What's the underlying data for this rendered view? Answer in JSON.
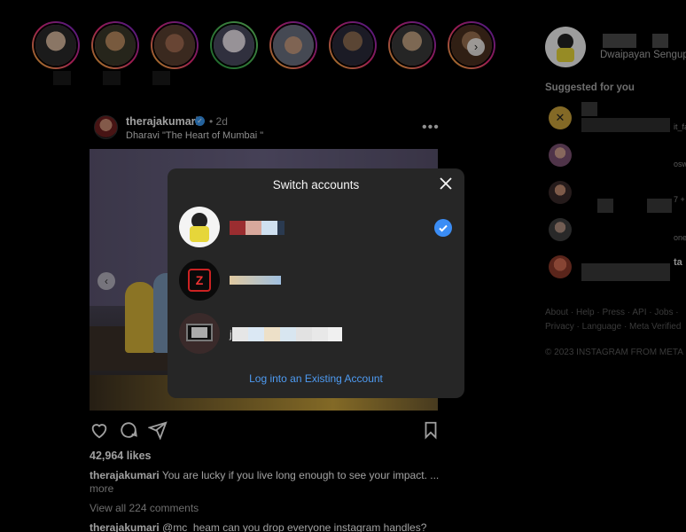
{
  "post": {
    "username": "therajakumari",
    "time": "2d",
    "location": "Dharavi \"The Heart of Mumbai \"",
    "likes": "42,964 likes",
    "caption_user": "therajakumari",
    "caption_text": "You are lucky if you live long enough to see your impact. ...",
    "caption_more": "more",
    "view_comments": "View all 224 comments",
    "comment_user": "therajakumari",
    "comment_text": "@mc_heam can you drop everyone instagram handles?"
  },
  "sidebar": {
    "full_name": "Dwaipayan Sengupta",
    "suggested_title": "Suggested for you",
    "suggestion_fragments": [
      "it_fa",
      "osw",
      "7 +",
      "one",
      "ta"
    ],
    "footer_links": "About · Help · Press · API · Jobs · Privacy · Language · Meta Verified",
    "copyright": "© 2023 INSTAGRAM FROM META"
  },
  "modal": {
    "title": "Switch accounts",
    "account_3_initial": "j",
    "login_link": "Log into an Existing Account"
  },
  "colors": {
    "accent_blue": "#3b8df5",
    "link_blue": "#4e9bf2",
    "modal_bg": "#262626",
    "page_bg": "#000000"
  },
  "icons": {
    "close": "close-icon",
    "check": "checkmark-circle-icon",
    "like": "heart-icon",
    "comment": "comment-bubble-icon",
    "share": "paper-plane-icon",
    "save": "bookmark-icon",
    "more": "more-options-icon"
  }
}
